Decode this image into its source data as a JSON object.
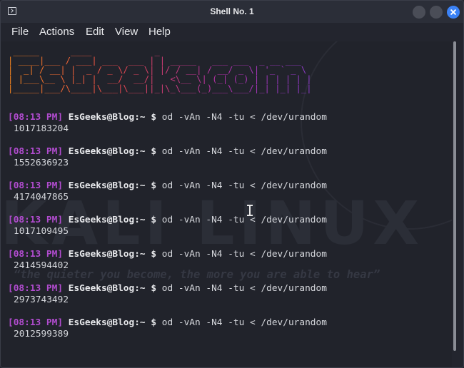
{
  "window": {
    "title": "Shell No. 1",
    "icon": "terminal-icon"
  },
  "menu": [
    {
      "label": "File"
    },
    {
      "label": "Actions"
    },
    {
      "label": "Edit"
    },
    {
      "label": "View"
    },
    {
      "label": "Help"
    }
  ],
  "banner": {
    "text": "EsGeeks.com",
    "ascii": " _____      ____            _\n| ____|___ / ___| ___  ___ | | _____   ___ ___  _ __ ___\n|  _| / __| |  _ / _ \\/ _ \\| |/ / __| / __/ _ \\| '_ ` _ \\\n| |___\\__ \\ |_| |  __/  __/|   <\\__ \\| (_| (_) | | | | | |\n|_____|___/\\____|\\___|\\___||_|\\_\\___(_)___\\___/|_| |_| |_|",
    "colors": [
      "#ff8a1d",
      "#e8484a",
      "#b030a8",
      "#8a3cc8"
    ]
  },
  "watermark": {
    "text": "KALI LINUX",
    "quote": "“the quieter you become, the more you are able to hear”"
  },
  "terminal": {
    "prompt_user": "EsGeeks@Blog:~ $",
    "entries": [
      {
        "time": "[08:13 PM]",
        "command": "od -vAn -N4 -tu < /dev/urandom",
        "output": "1017183204"
      },
      {
        "time": "[08:13 PM]",
        "command": "od -vAn -N4 -tu < /dev/urandom",
        "output": "1552636923"
      },
      {
        "time": "[08:13 PM]",
        "command": "od -vAn -N4 -tu < /dev/urandom",
        "output": "4174047865"
      },
      {
        "time": "[08:13 PM]",
        "command": "od -vAn -N4 -tu < /dev/urandom",
        "output": "1017109495"
      },
      {
        "time": "[08:13 PM]",
        "command": "od -vAn -N4 -tu < /dev/urandom",
        "output": "2414594402"
      },
      {
        "time": "[08:13 PM]",
        "command": "od -vAn -N4 -tu < /dev/urandom",
        "output": "2973743492"
      },
      {
        "time": "[08:13 PM]",
        "command": "od -vAn -N4 -tu < /dev/urandom",
        "output": "2012599389"
      }
    ]
  },
  "colors": {
    "background": "#21232b",
    "time": "#b24cd0",
    "close_button": "#3b82f6"
  }
}
